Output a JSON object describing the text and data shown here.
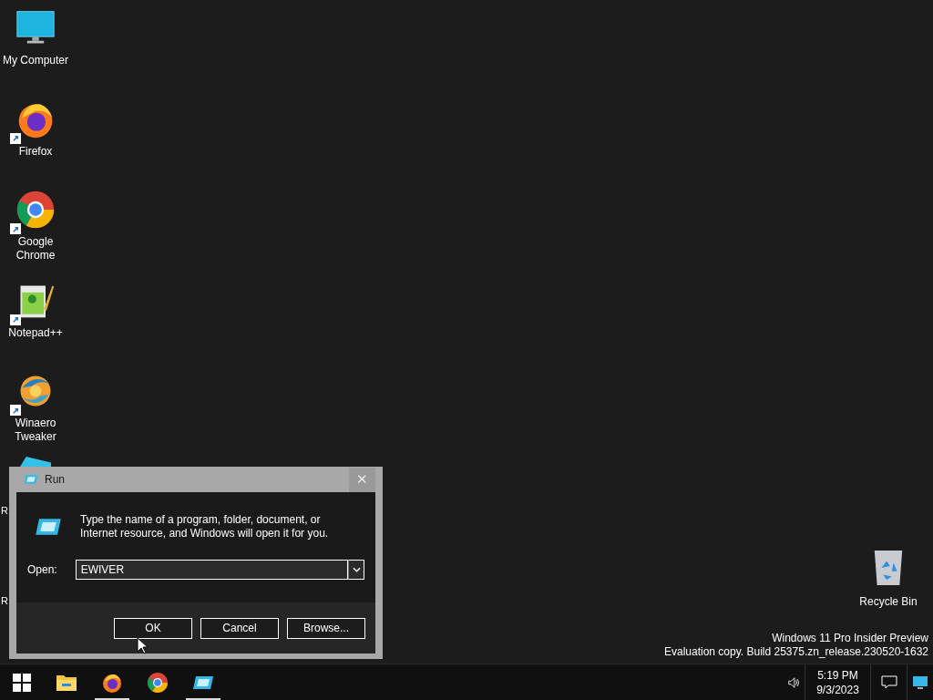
{
  "desktop_icons": [
    {
      "kind": "computer",
      "label": "My Computer",
      "shortcut": false
    },
    {
      "kind": "firefox",
      "label": "Firefox",
      "shortcut": true
    },
    {
      "kind": "chrome",
      "label": "Google Chrome",
      "shortcut": true
    },
    {
      "kind": "notepad",
      "label": "Notepad++",
      "shortcut": true
    },
    {
      "kind": "winaero",
      "label": "Winaero Tweaker",
      "shortcut": true
    }
  ],
  "hidden_labels": [
    "R",
    "R"
  ],
  "recycle_bin": {
    "label": "Recycle Bin"
  },
  "build_info": [
    "Windows 11 Pro Insider Preview",
    "Evaluation copy. Build 25375.zn_release.230520-1632"
  ],
  "run_dialog": {
    "title": "Run",
    "close_glyph": "✕",
    "description": "Type the name of a program, folder, document, or Internet resource, and Windows will open it for you.",
    "open_label": "Open:",
    "value": "EWIVER",
    "buttons": [
      "OK",
      "Cancel",
      "Browse..."
    ]
  },
  "taskbar": {
    "apps": [
      {
        "kind": "start",
        "running": false
      },
      {
        "kind": "explorer",
        "running": false
      },
      {
        "kind": "firefox",
        "running": true
      },
      {
        "kind": "chrome",
        "running": false
      },
      {
        "kind": "run",
        "running": true
      }
    ],
    "time": "5:19 PM",
    "date": "9/3/2023"
  }
}
